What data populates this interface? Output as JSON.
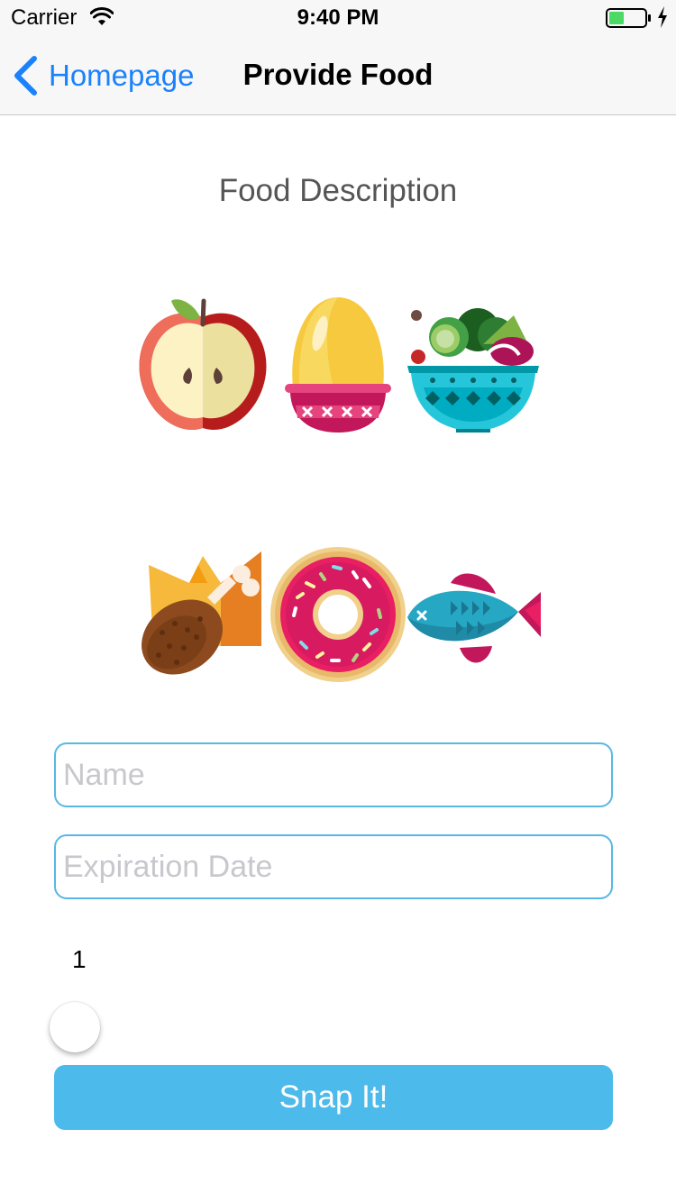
{
  "status_bar": {
    "carrier": "Carrier",
    "time": "9:40 PM",
    "battery_color": "#4cd964"
  },
  "nav_bar": {
    "back_label": "Homepage",
    "title": "Provide Food",
    "tint_color": "#1a82fb"
  },
  "main": {
    "section_title": "Food Description",
    "food_icons": [
      "apple-icon",
      "egg-icon",
      "salad-bowl-icon",
      "chicken-drumstick-icon",
      "donut-icon",
      "fish-icon"
    ],
    "name_field": {
      "placeholder": "Name",
      "value": ""
    },
    "expiration_field": {
      "placeholder": "Expiration Date",
      "value": ""
    },
    "quantity_label": "1",
    "quantity_slider": {
      "value": 1,
      "position_fraction": 0
    },
    "snap_button_label": "Snap It!",
    "accent_color": "#4cbaea"
  }
}
